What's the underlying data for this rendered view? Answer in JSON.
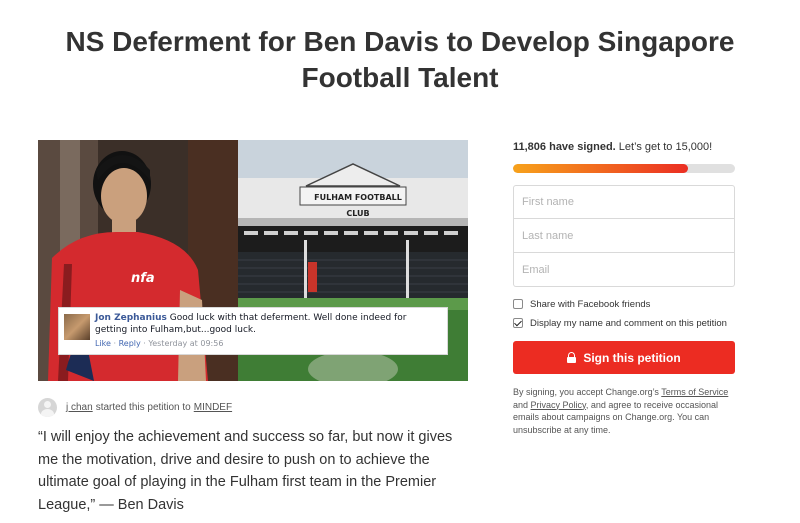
{
  "petition": {
    "title": "NS Deferment for Ben Davis to Develop Singapore Football Talent",
    "starter": {
      "name": "j chan",
      "action": "started this petition to",
      "target": "MINDEF"
    },
    "quote": "“I will enjoy the achievement and success so far, but now it gives me the motivation, drive and desire to push on to achieve the ultimate goal of playing in the Fulham first team in the Premier League,” — Ben Davis"
  },
  "hero_image": {
    "stadium_sign": "FULHAM FOOTBALL CLUB",
    "shirt_logo": "nfa",
    "comment": {
      "author": "Jon Zephanius",
      "text": "Good luck with that deferment. Well done indeed for getting into Fulham,but...good luck.",
      "like": "Like",
      "reply": "Reply",
      "time": "Yesterday at 09:56",
      "separator": "·"
    }
  },
  "sign_panel": {
    "count_bold": "11,806 have signed.",
    "count_goal": "Let’s get to 15,000!",
    "progress_fraction": 0.787,
    "colors": {
      "progress_start": "#f7a21b",
      "progress_end": "#eb2e23",
      "button": "#ec2c22"
    },
    "fields": {
      "first_name": "First name",
      "last_name": "Last name",
      "email": "Email"
    },
    "share_facebook": {
      "label": "Share with Facebook friends",
      "checked": false
    },
    "display_name": {
      "label": "Display my name and comment on this petition",
      "checked": true
    },
    "button_label": "Sign this petition",
    "button_icon": "lock-icon",
    "legal": {
      "prefix": "By signing, you accept Change.org’s ",
      "terms": "Terms of Service",
      "and": " and ",
      "privacy": "Privacy Policy",
      "suffix": ", and agree to receive occasional emails about campaigns on Change.org. You can unsubscribe at any time."
    }
  }
}
